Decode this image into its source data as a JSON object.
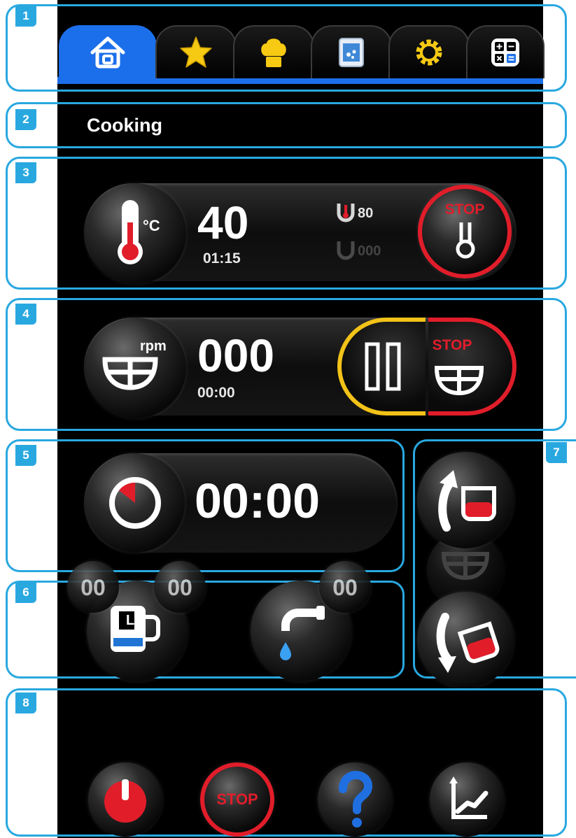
{
  "frame_labels": [
    "1",
    "2",
    "3",
    "4",
    "5",
    "6",
    "7",
    "8"
  ],
  "tabs": [
    {
      "icon": "home-icon",
      "active": true
    },
    {
      "icon": "star-icon",
      "active": false
    },
    {
      "icon": "chef-hat-icon",
      "active": false
    },
    {
      "icon": "recipe-image-icon",
      "active": false
    },
    {
      "icon": "gear-icon",
      "active": false
    },
    {
      "icon": "calculator-icon",
      "active": false
    }
  ],
  "page_title": "Cooking",
  "temperature": {
    "unit": "°C",
    "value": "40",
    "time": "01:15",
    "probe_value": "80",
    "probe2_value": "000",
    "stop_label": "STOP"
  },
  "mixer": {
    "unit": "rpm",
    "value": "000",
    "time": "00:00",
    "stop_label": "STOP"
  },
  "timer": {
    "value": "00:00"
  },
  "dosing": {
    "liters_count": "00",
    "liters_sub": "00",
    "liters_icon_label": "L",
    "water_count": "00"
  },
  "footer": {
    "stop_label": "STOP"
  },
  "colors": {
    "accent": "#29a8e0",
    "tab_active": "#1c6fea",
    "stop": "#e11d2a",
    "pause": "#f2c218",
    "water": "#1f74d4"
  }
}
